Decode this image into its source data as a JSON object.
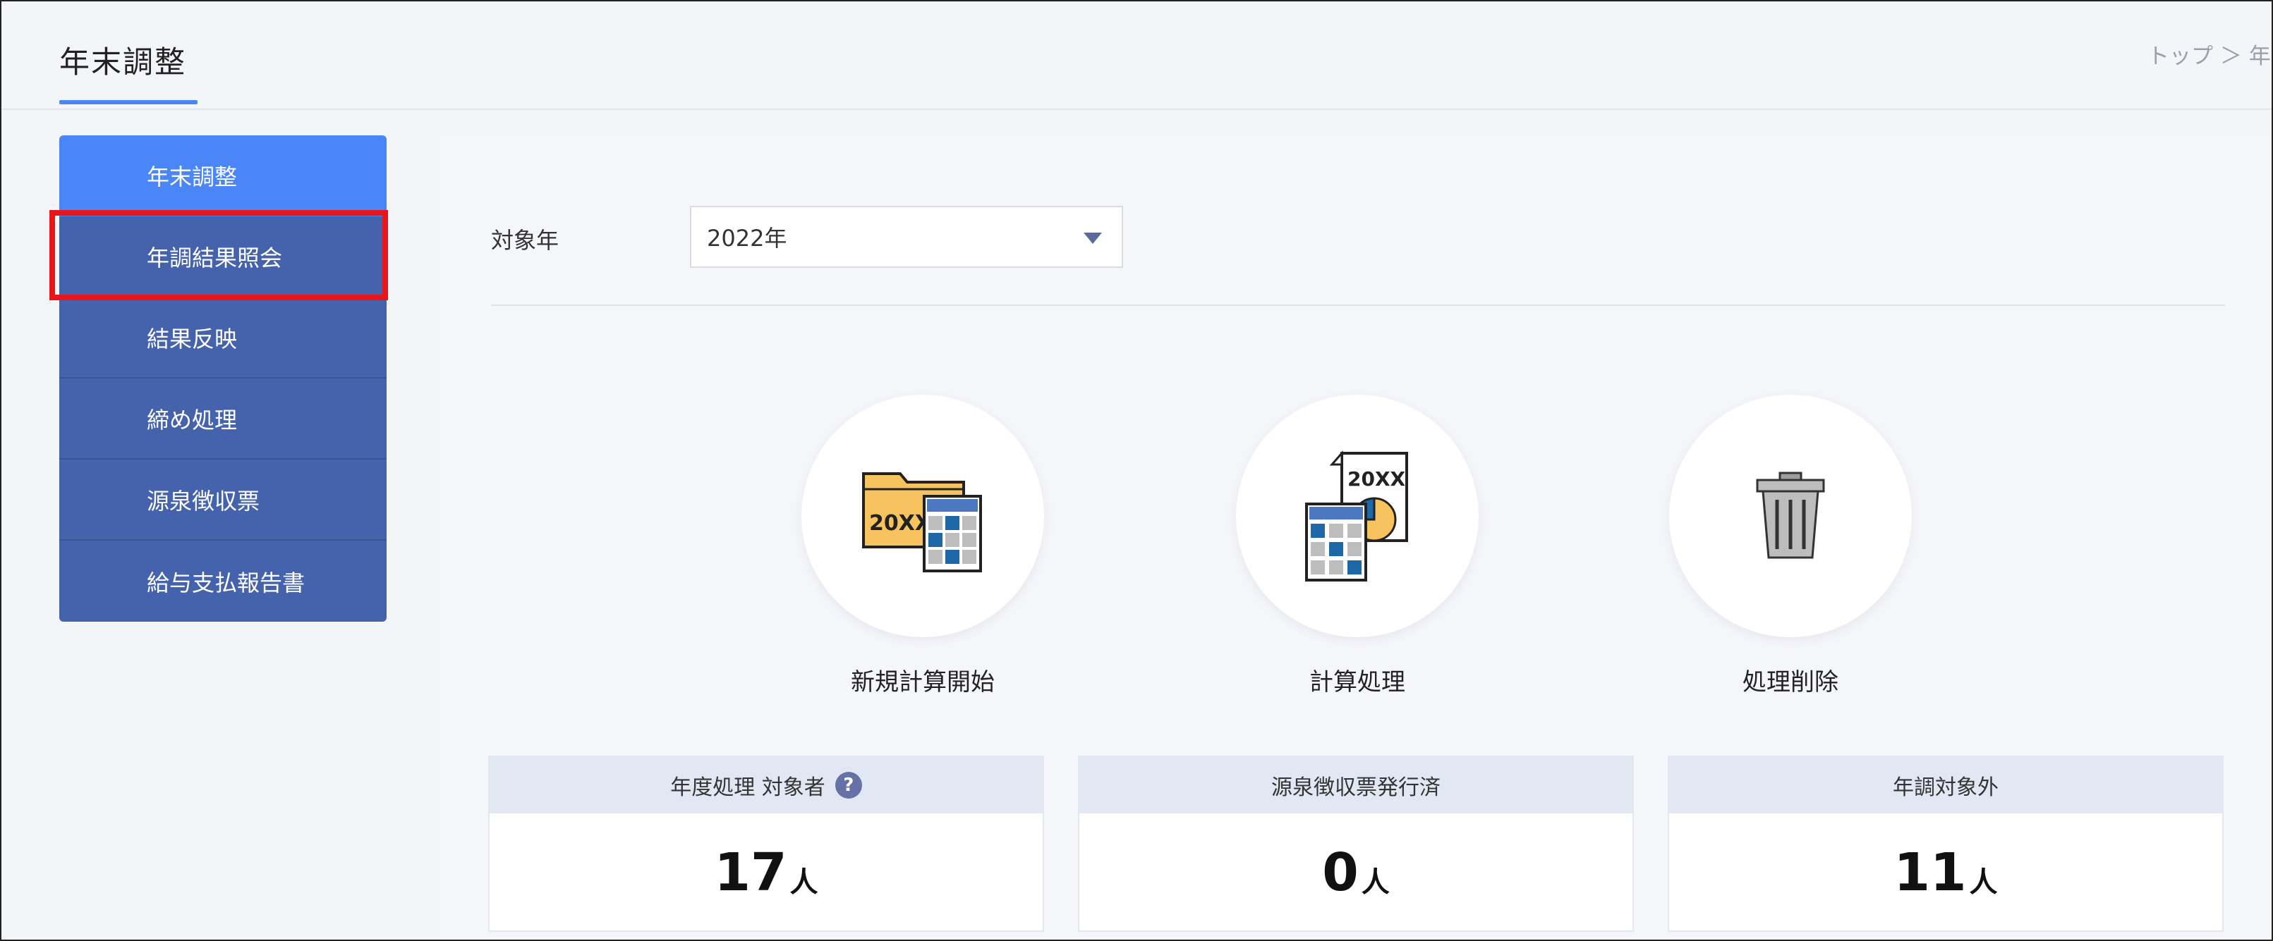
{
  "header": {
    "title": "年末調整",
    "breadcrumb": "トップ ＞ 年末"
  },
  "sidebar": {
    "items": [
      {
        "label": "年末調整"
      },
      {
        "label": "年調結果照会"
      },
      {
        "label": "結果反映"
      },
      {
        "label": "締め処理"
      },
      {
        "label": "源泉徴収票"
      },
      {
        "label": "給与支払報告書"
      }
    ],
    "active_index": 0,
    "highlighted_index": 1
  },
  "filter": {
    "label": "対象年",
    "selected": "2022年"
  },
  "actions": [
    {
      "label": "新規計算開始",
      "icon": "folder-calculator-icon",
      "badge": "20XX"
    },
    {
      "label": "計算処理",
      "icon": "document-calculator-icon",
      "badge": "20XX"
    },
    {
      "label": "処理削除",
      "icon": "trash-icon"
    }
  ],
  "stats": [
    {
      "title": "年度処理 対象者",
      "value": "17",
      "unit": "人",
      "help": "?"
    },
    {
      "title": "源泉徴収票発行済",
      "value": "0",
      "unit": "人"
    },
    {
      "title": "年調対象外",
      "value": "11",
      "unit": "人"
    }
  ],
  "colors": {
    "accent": "#4a86f7",
    "sidebar": "#4563ad",
    "highlight": "#e8161b",
    "card_head": "#e2e7f4"
  }
}
